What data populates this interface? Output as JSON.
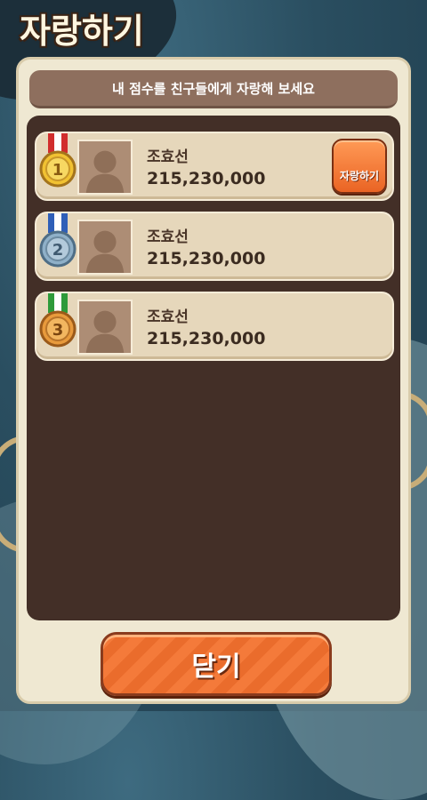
{
  "screen": {
    "title": "자랑하기",
    "instruction": "내 점수를 친구들에게 자랑해 보세요"
  },
  "ranking": [
    {
      "rank": 1,
      "medal": "gold-medal-icon",
      "name": "조효선",
      "score": "215,230,000",
      "action_label": "자랑하기"
    },
    {
      "rank": 2,
      "medal": "silver-medal-icon",
      "name": "조효선",
      "score": "215,230,000"
    },
    {
      "rank": 3,
      "medal": "bronze-medal-icon",
      "name": "조효선",
      "score": "215,230,000"
    }
  ],
  "buttons": {
    "close_label": "닫기"
  },
  "colors": {
    "panel": "#efe8d2",
    "list_bg": "#432f27",
    "accent_orange": "#ea6424",
    "gold": "#f1c232",
    "silver": "#8fb0c8",
    "bronze": "#e89a3c"
  }
}
